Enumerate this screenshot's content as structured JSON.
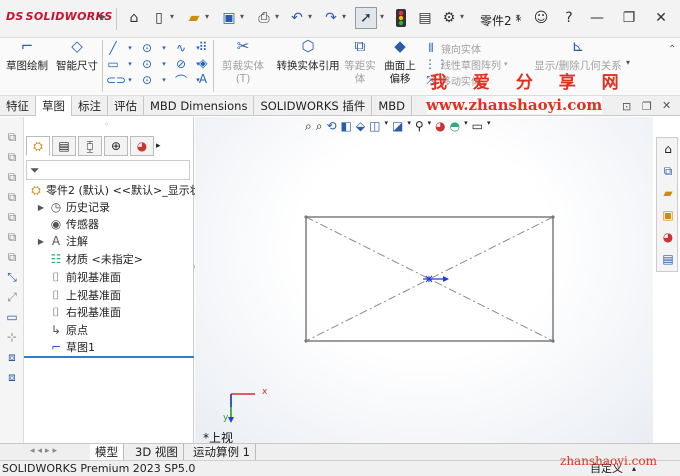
{
  "app": {
    "logo_text": "SOLIDWORKS",
    "logo_prefix": "DS",
    "doc_name": "零件2 *"
  },
  "titlebar_icons": [
    "home-icon",
    "new-file-icon",
    "open-icon",
    "save-icon",
    "print-icon",
    "undo-icon",
    "redo-icon",
    "select-icon",
    "traffic-light-icon",
    "file-properties-icon",
    "options-gear-icon"
  ],
  "commands": {
    "sketch": "草图绘制",
    "smart_dim": "智能尺寸",
    "trim": "剪裁实体(T)",
    "convert": "转换实体引用",
    "offset": "等距实体",
    "surface_offset_1": "曲面上",
    "surface_offset_2": "偏移",
    "mirror": "镜向实体",
    "linear_pattern": "线性草图阵列",
    "move": "移动实体",
    "relations": "显示/删除几何关系"
  },
  "tabs": [
    "特征",
    "草图",
    "标注",
    "评估",
    "MBD Dimensions",
    "SOLIDWORKS 插件",
    "MBD"
  ],
  "active_tab": 1,
  "watermark": {
    "cn": "我 爱 分 享 网",
    "url": "www.zhanshaoyi.com",
    "url_bottom": "zhanshaoyi.com"
  },
  "tree": {
    "root": "零件2 (默认) <<默认>_显示状",
    "items": [
      {
        "label": "历史记录",
        "icon": "history-icon",
        "arrow": true
      },
      {
        "label": "传感器",
        "icon": "sensor-icon",
        "arrow": false
      },
      {
        "label": "注解",
        "icon": "annotation-icon",
        "arrow": true
      },
      {
        "label": "材质 <未指定>",
        "icon": "material-icon",
        "arrow": false
      },
      {
        "label": "前视基准面",
        "icon": "plane-icon",
        "arrow": false
      },
      {
        "label": "上视基准面",
        "icon": "plane-icon",
        "arrow": false
      },
      {
        "label": "右视基准面",
        "icon": "plane-icon",
        "arrow": false
      },
      {
        "label": "原点",
        "icon": "origin-icon",
        "arrow": false
      },
      {
        "label": "草图1",
        "icon": "sketch-icon",
        "arrow": false
      }
    ]
  },
  "viewport": {
    "view_label": "*上视",
    "axis_x": "x",
    "axis_y": "y"
  },
  "bottom_tabs": [
    "模型",
    "3D 视图",
    "运动算例 1"
  ],
  "status": {
    "left": "SOLIDWORKS Premium 2023 SP5.0",
    "right": "自定义"
  }
}
